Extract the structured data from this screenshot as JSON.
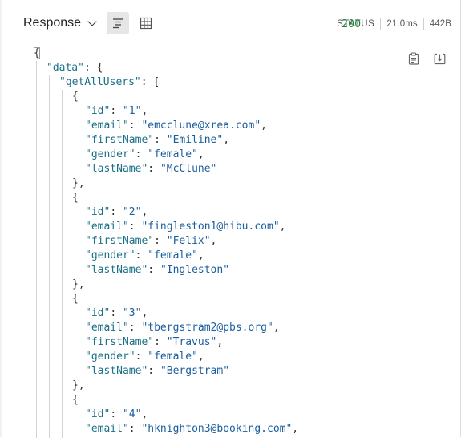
{
  "header": {
    "title": "Response",
    "status_label": "STATUS",
    "status_code": "200",
    "time": "21.0ms",
    "size": "442B"
  },
  "colors": {
    "key": "#1b7088",
    "string": "#1b5e9e",
    "status_ok": "#1a7f37"
  },
  "icons": {
    "pretty_view": "pretty-view-icon",
    "table_view": "table-view-icon",
    "copy": "clipboard-icon",
    "download": "download-icon"
  },
  "json_body": {
    "root_key": "data",
    "query_key": "getAllUsers",
    "users": [
      {
        "id": "1",
        "email": "emcclune@xrea.com",
        "firstName": "Emiline",
        "gender": "female",
        "lastName": "McClune"
      },
      {
        "id": "2",
        "email": "fingleston1@hibu.com",
        "firstName": "Felix",
        "gender": "female",
        "lastName": "Ingleston"
      },
      {
        "id": "3",
        "email": "tbergstram2@pbs.org",
        "firstName": "Travus",
        "gender": "female",
        "lastName": "Bergstram"
      },
      {
        "id": "4",
        "email": "hknighton3@booking.com"
      }
    ]
  }
}
